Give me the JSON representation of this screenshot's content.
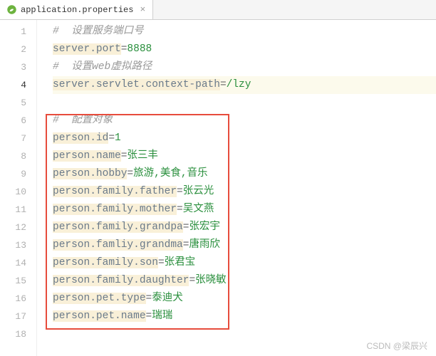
{
  "tab": {
    "filename": "application.properties"
  },
  "lines": [
    {
      "n": "1",
      "type": "comment",
      "text": "#  设置服务端口号"
    },
    {
      "n": "2",
      "type": "kv",
      "key": "server.port",
      "val": "8888"
    },
    {
      "n": "3",
      "type": "comment",
      "text": "#  设置web虚拟路径"
    },
    {
      "n": "4",
      "type": "kv",
      "key": "server.servlet.context-path",
      "val": "/lzy"
    },
    {
      "n": "5",
      "type": "blank",
      "text": ""
    },
    {
      "n": "6",
      "type": "comment",
      "text": "#  配置对象"
    },
    {
      "n": "7",
      "type": "kv",
      "key": "person.id",
      "val": "1"
    },
    {
      "n": "8",
      "type": "kv",
      "key": "person.name",
      "val": "张三丰"
    },
    {
      "n": "9",
      "type": "kv",
      "key": "person.hobby",
      "val": "旅游,美食,音乐"
    },
    {
      "n": "10",
      "type": "kv",
      "key": "person.family.father",
      "val": "张云光"
    },
    {
      "n": "11",
      "type": "kv",
      "key": "person.family.mother",
      "val": "吴文燕"
    },
    {
      "n": "12",
      "type": "kv",
      "key": "person.family.grandpa",
      "val": "张宏宇"
    },
    {
      "n": "13",
      "type": "kv",
      "key": "person.famliy.grandma",
      "val": "唐雨欣"
    },
    {
      "n": "14",
      "type": "kv",
      "key": "person.family.son",
      "val": "张君宝"
    },
    {
      "n": "15",
      "type": "kv",
      "key": "person.family.daughter",
      "val": "张晓敏"
    },
    {
      "n": "16",
      "type": "kv",
      "key": "person.pet.type",
      "val": "泰迪犬"
    },
    {
      "n": "17",
      "type": "kv",
      "key": "person.pet.name",
      "val": "瑞瑞"
    },
    {
      "n": "18",
      "type": "blank",
      "text": ""
    }
  ],
  "currentLine": 4,
  "attribution": "CSDN @梁辰兴"
}
